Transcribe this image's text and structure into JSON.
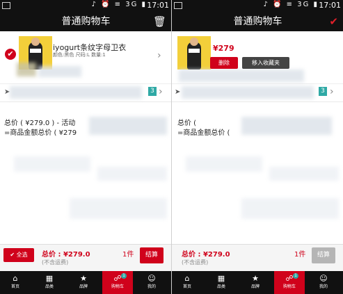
{
  "status_bar": {
    "icons": "♪ ⏰ ≡ 3G ▮",
    "time": "17:01"
  },
  "left": {
    "title": "普通购物车",
    "header_action_icon": "trash-icon",
    "check_icon": "✔",
    "product": {
      "name": "iyogurt条纹字母卫衣",
      "attrs": "颜色:黑色 尺码:L 数量:1"
    },
    "promo_badge": "3",
    "summary_line1": "总价 ( ¥279.0 ) - 活动",
    "summary_line2": "=商品金额总价 ( ¥279",
    "select_all": "✔ 全选",
    "total_label": "总价 : ¥279.0",
    "shipping_note": "(不含运费)",
    "count": "1件",
    "checkout": "结算",
    "accent": "#d0021b"
  },
  "right": {
    "title": "普通购物车",
    "header_action_icon": "checkmark-icon",
    "price": "¥279",
    "delete": "删除",
    "move_to_favorites": "移入收藏夹",
    "promo_badge": "3",
    "summary_line1": "总价 (",
    "summary_line2": "=商品金额总价 (",
    "total_label": "总价 : ¥279.0",
    "shipping_note": "(不含运费)",
    "count": "1件",
    "checkout": "结算",
    "checkout_color": "#b5b5b5"
  },
  "tabbar": {
    "items": [
      {
        "label": "首页",
        "icon": "home-icon"
      },
      {
        "label": "品类",
        "icon": "grid-icon"
      },
      {
        "label": "品牌",
        "icon": "tag-icon"
      },
      {
        "label": "购物车",
        "icon": "cart-icon",
        "badge": "1"
      },
      {
        "label": "我的",
        "icon": "user-icon"
      }
    ]
  }
}
